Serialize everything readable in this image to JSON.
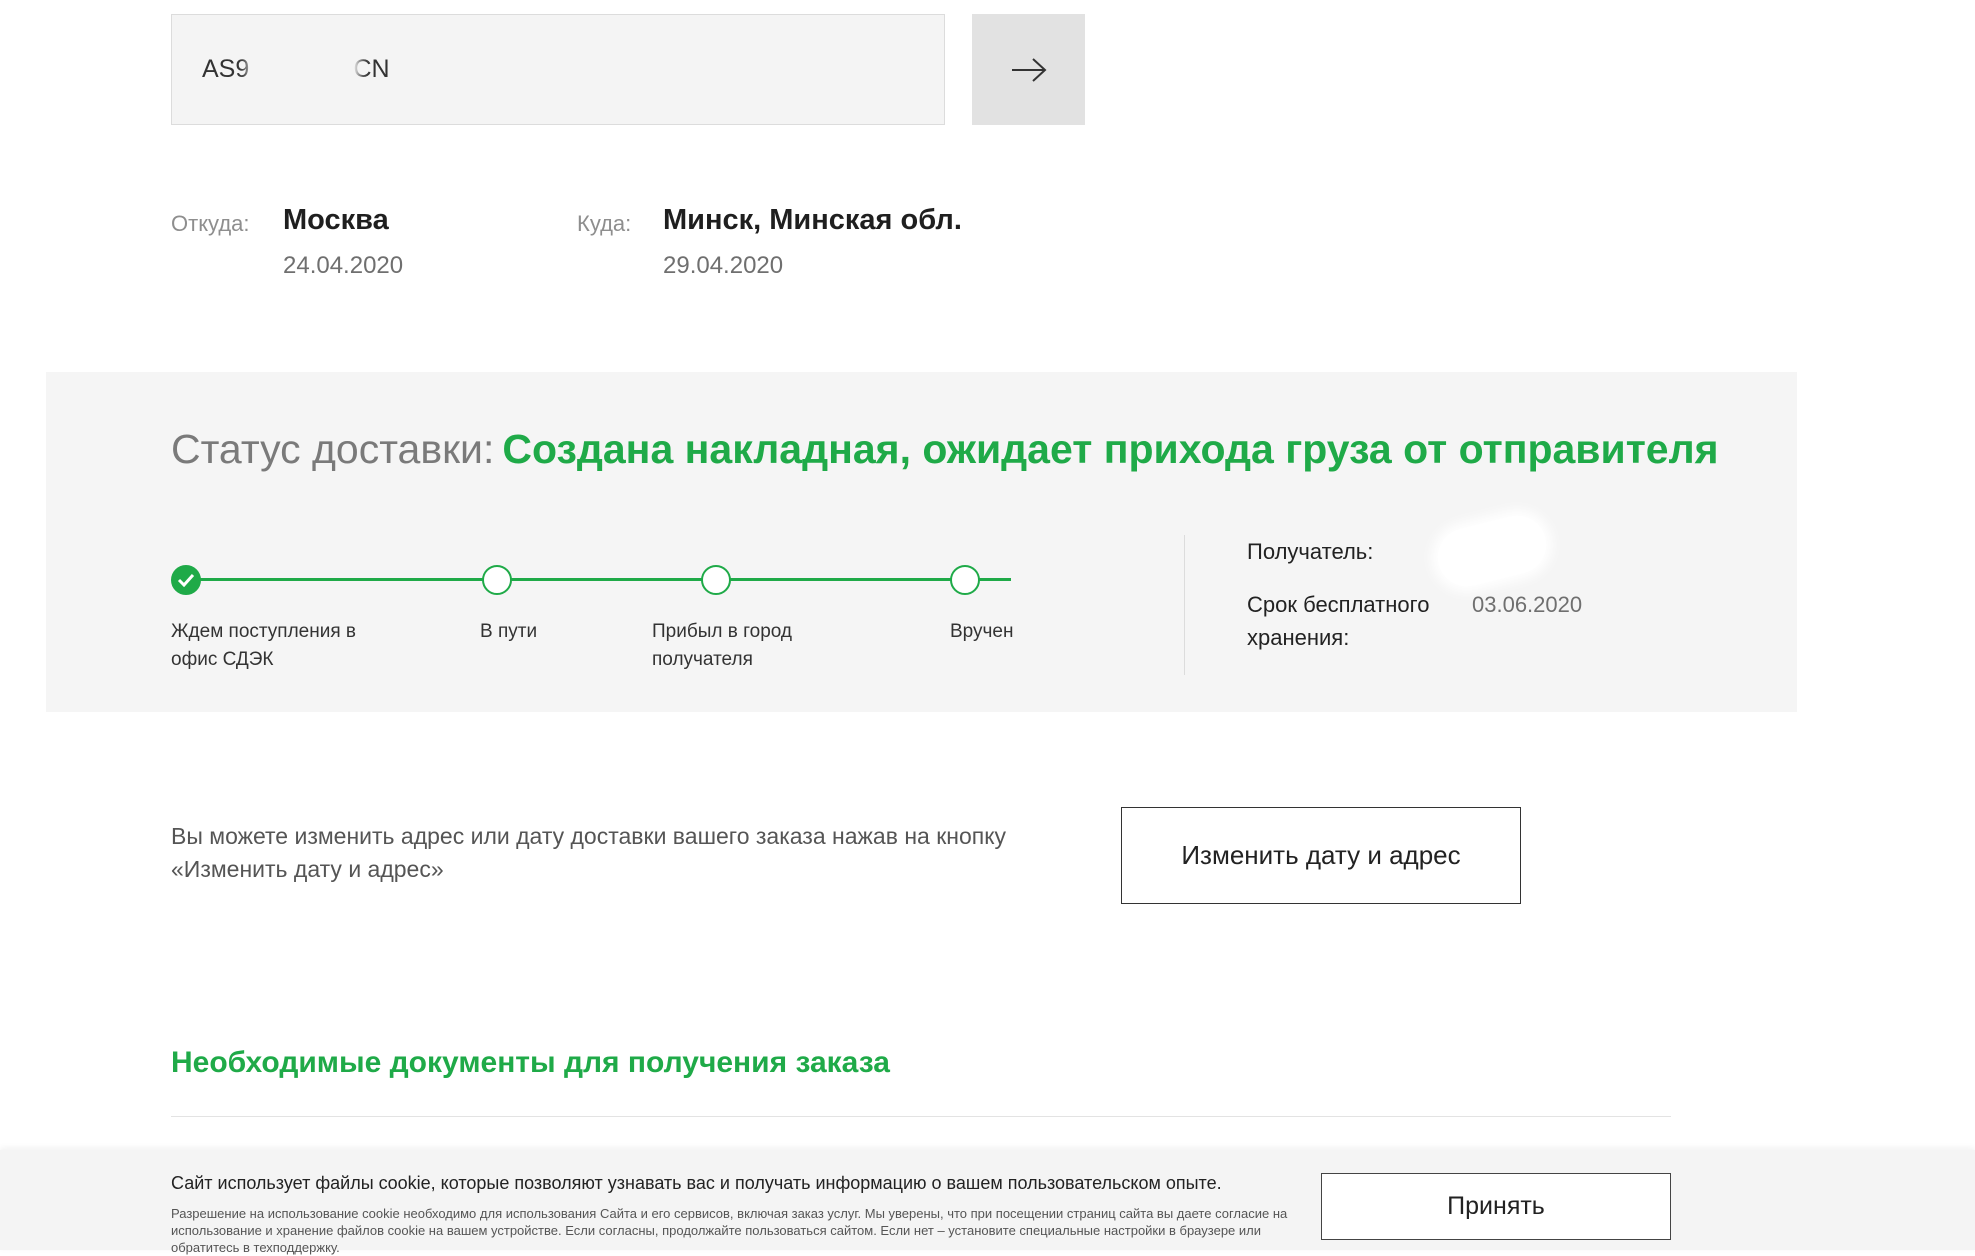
{
  "search": {
    "value": "AS9             4CN",
    "submit_icon": "arrow-right-icon"
  },
  "route": {
    "from_label": "Откуда:",
    "from_city": "Москва",
    "from_date": "24.04.2020",
    "to_label": "Куда:",
    "to_city": "Минск, Минская обл.",
    "to_date": "29.04.2020"
  },
  "status": {
    "prefix": "Статус доставки:",
    "value": "Создана накладная, ожидает прихода груза от отправителя",
    "accent_color": "#1faa48",
    "steps": [
      {
        "line1": "Ждем поступления в",
        "line2": "офис СДЭК",
        "done": true
      },
      {
        "line1": "В пути",
        "line2": "",
        "done": false
      },
      {
        "line1": "Прибыл в город",
        "line2": "получателя",
        "done": false
      },
      {
        "line1": "Вручен",
        "line2": "",
        "done": false
      }
    ],
    "recipient_label": "Получатель:",
    "storage_label_1": "Срок бесплатного",
    "storage_label_2": "хранения:",
    "storage_value": "03.06.2020"
  },
  "change": {
    "text_1": "Вы можете изменить адрес или дату доставки вашего заказа нажав на кнопку",
    "text_2": "«Изменить дату и адрес»",
    "button_label": "Изменить дату и адрес"
  },
  "docs": {
    "title": "Необходимые документы для получения заказа"
  },
  "cookie": {
    "main_text": "Сайт использует файлы cookie, которые позволяют узнавать вас и получать информацию о вашем пользовательском опыте.",
    "small_text": "Разрешение на использование cookie необходимо для использования Сайта и его сервисов, включая заказ услуг. Мы уверены, что при посещении страниц сайта вы даете согласие на использование и хранение файлов cookie на вашем устройстве. Если согласны, продолжайте пользоваться сайтом. Если нет – установите специальные настройки в браузере или обратитесь в техподдержку.",
    "accept_label": "Принять"
  }
}
